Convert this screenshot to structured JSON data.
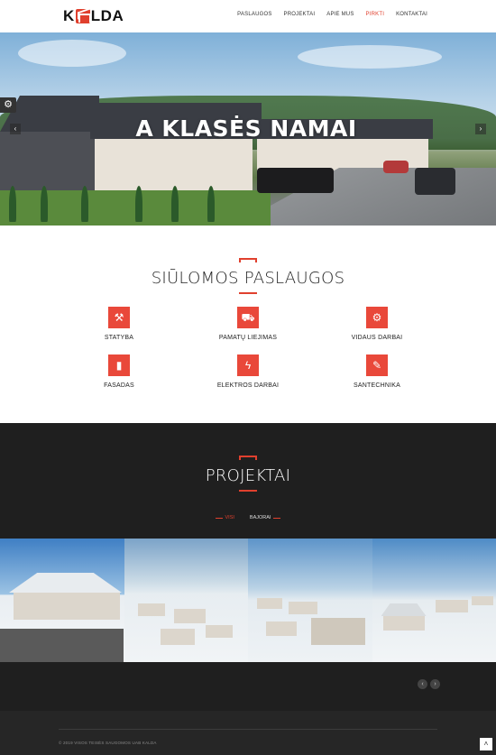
{
  "header": {
    "logo_left": "K",
    "logo_right": "LDA",
    "nav": [
      {
        "label": "PASLAUGOS",
        "active": false
      },
      {
        "label": "PROJEKTAI",
        "active": false
      },
      {
        "label": "APIE MUS",
        "active": false
      },
      {
        "label": "PIRKTI",
        "active": true
      },
      {
        "label": "KONTAKTAI",
        "active": false
      }
    ]
  },
  "hero": {
    "title": "A KLASĖS NAMAI",
    "prev_icon": "chevron-left-icon",
    "next_icon": "chevron-right-icon",
    "settings_icon": "gear-icon"
  },
  "services": {
    "title": "SIŪLOMOS PASLAUGOS",
    "items": [
      {
        "label": "STATYBA",
        "icon": "hammer-icon"
      },
      {
        "label": "PAMATŲ LIEJIMAS",
        "icon": "tractor-icon"
      },
      {
        "label": "VIDAUS DARBAI",
        "icon": "drill-icon"
      },
      {
        "label": "FASADAS",
        "icon": "paint-roller-icon"
      },
      {
        "label": "ELEKTROS DARBAI",
        "icon": "lightning-icon"
      },
      {
        "label": "SANTECHNIKA",
        "icon": "wrench-icon"
      }
    ]
  },
  "projects": {
    "title": "PROJEKTAI",
    "filters": [
      {
        "label": "VISI",
        "active": true
      },
      {
        "label": "BAJORAI",
        "active": false
      }
    ]
  },
  "footer": {
    "copyright": "© 2019 VISOS TEISĖS SAUGOMOS UAB KALDA"
  },
  "colors": {
    "accent": "#e0402e",
    "dark_bg": "#1f1f1f",
    "footer_bg": "#262626"
  }
}
